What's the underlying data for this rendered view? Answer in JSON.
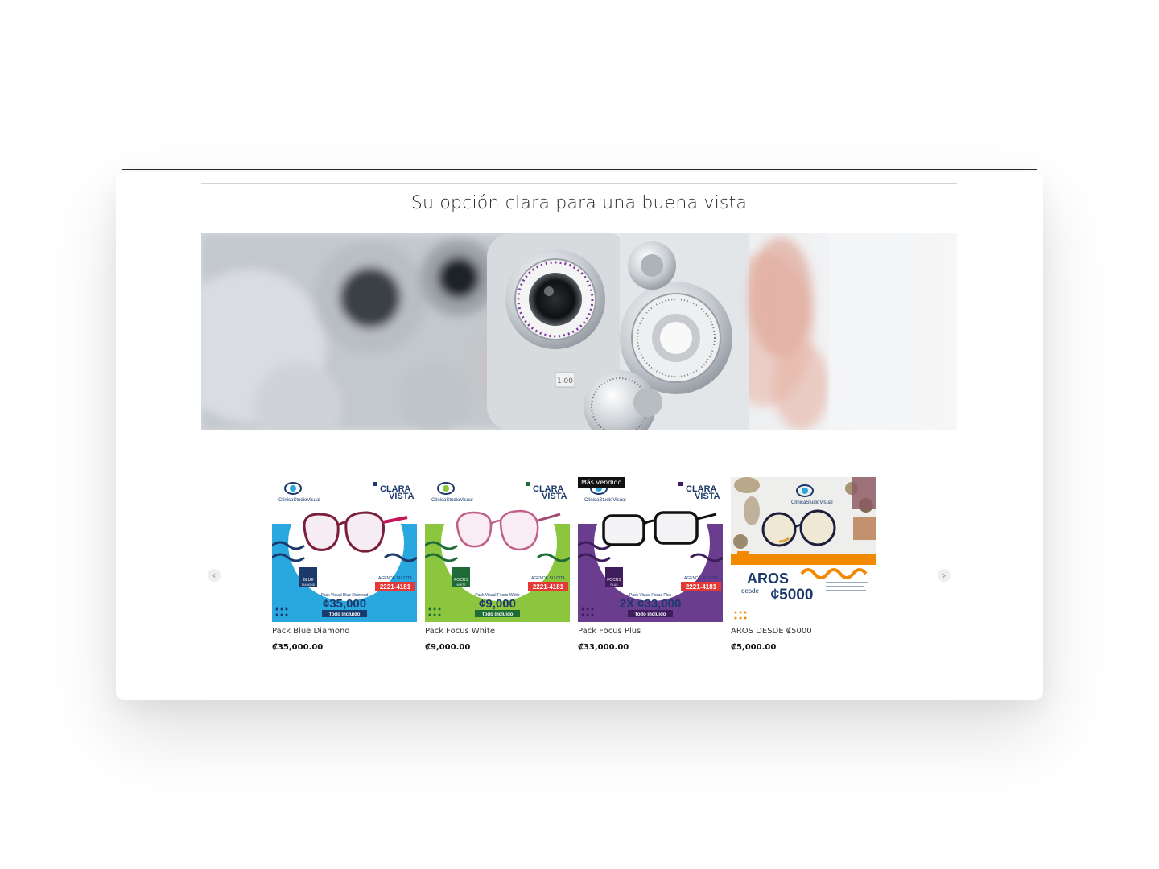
{
  "page": {
    "headline": "Su opción clara para una buena vista"
  },
  "hero": {
    "image": "phoropter-eye-exam-photo"
  },
  "carousel": {
    "prev_icon": "chevron-left-icon",
    "next_icon": "chevron-right-icon",
    "prev_glyph": "‹",
    "next_glyph": "›"
  },
  "ad_common": {
    "brand": "ClínicaStudioVisual",
    "slogan_small": "Su opción clara para una buena",
    "slogan_clara": "CLARA",
    "slogan_vista": "VISTA",
    "call_label": "AGENDE SU CITA",
    "phone": "2221-4181",
    "included": "Todo incluido"
  },
  "products": [
    {
      "name": "Pack Blue Diamond",
      "price": "₡35,000.00",
      "badge": "",
      "ad_pack_label": "Pack Visual Blue Diamond",
      "ad_price": "¢35,000",
      "ad_logo_line1": "BLUE",
      "ad_logo_line2": "DIAMOND",
      "bg_color": "#29a8e0"
    },
    {
      "name": "Pack Focus White",
      "price": "₡9,000.00",
      "badge": "",
      "ad_pack_label": "Pack Visual Focus White",
      "ad_price": "¢9,000",
      "ad_logo_line1": "FOCUS",
      "ad_logo_line2": "WHITE",
      "bg_color": "#8cc63f"
    },
    {
      "name": "Pack Focus Plus",
      "price": "₡33,000.00",
      "badge": "Más vendido",
      "ad_pack_label": "Pack Visual Focus Plus",
      "ad_price": "2X ¢33,000",
      "ad_logo_line1": "FOCUS",
      "ad_logo_line2": "PLUS",
      "bg_color": "#6b3d8f"
    },
    {
      "name": "AROS DESDE ₡5000",
      "price": "₡5,000.00",
      "badge": "",
      "ad_title": "AROS",
      "ad_desde": "desde",
      "ad_price": "¢5000",
      "bg_color": "#ffffff"
    }
  ],
  "colors": {
    "accent_orange": "#f18a00",
    "accent_red": "#e53935",
    "navy": "#1b3a6b"
  }
}
